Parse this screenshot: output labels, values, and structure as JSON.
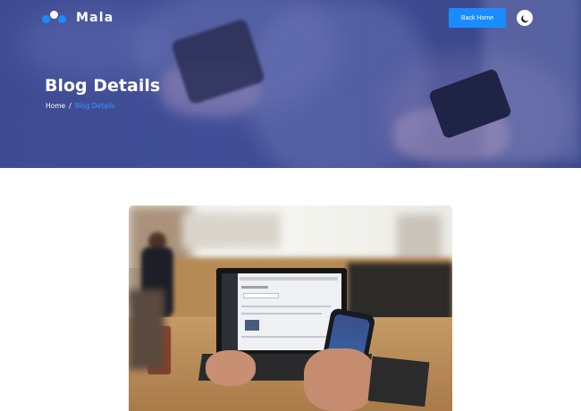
{
  "header": {
    "brand_name": "Mala",
    "back_home_label": "Back Home",
    "logo_colors": [
      "#1a8cff",
      "#ffffff",
      "#1a8cff"
    ]
  },
  "hero": {
    "title": "Blog Details",
    "breadcrumb": {
      "home": "Home",
      "separator": "/",
      "current": "Blog Details"
    }
  },
  "colors": {
    "accent": "#1a8cff",
    "hero_overlay": "#3f4c93"
  },
  "icons": {
    "theme_toggle": "moon-icon",
    "logo": "mala-logo-icon"
  }
}
